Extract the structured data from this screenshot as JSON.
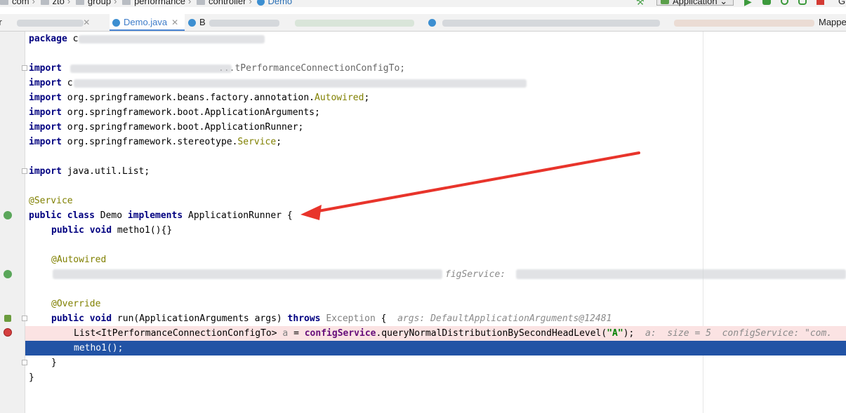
{
  "breadcrumb": {
    "items": [
      {
        "label": "com",
        "icon": "folder-icon"
      },
      {
        "label": "zto",
        "icon": "folder-icon"
      },
      {
        "label": "group",
        "icon": "folder-icon"
      },
      {
        "label": "performance",
        "icon": "folder-icon"
      },
      {
        "label": "controller",
        "icon": "folder-icon"
      },
      {
        "label": "Demo",
        "icon": "class-icon"
      }
    ]
  },
  "toolbar": {
    "run_config": "Application",
    "git_label": "G"
  },
  "tabs": [
    {
      "label": "rr",
      "active": false
    },
    {
      "label": "Demo.java",
      "active": true
    },
    {
      "label": "B",
      "active": false
    },
    {
      "label": "",
      "active": false
    },
    {
      "label": "Mappe",
      "active": false
    }
  ],
  "code": {
    "line1": {
      "kw": "package",
      "rest": " c"
    },
    "line3": {
      "kw": "import",
      "rest": " ",
      "tail": "...tPerformanceConnectionConfigTo;"
    },
    "line4": {
      "kw": "import",
      "rest": " c"
    },
    "line5": {
      "kw": "import",
      "rest": " org.springframework.beans.factory.annotation.",
      "ann": "Autowired",
      "end": ";"
    },
    "line6": {
      "kw": "import",
      "rest": " org.springframework.boot.ApplicationArguments;"
    },
    "line7": {
      "kw": "import",
      "rest": " org.springframework.boot.ApplicationRunner;"
    },
    "line8": {
      "kw": "import",
      "rest": " org.springframework.stereotype.",
      "ann": "Service",
      "end": ";"
    },
    "line10": {
      "kw": "import",
      "rest": " java.util.List;"
    },
    "line12": {
      "ann": "@Service"
    },
    "line13": {
      "kw1": "public class",
      "name": " Demo ",
      "kw2": "implements",
      "rest": " ApplicationRunner {"
    },
    "line14": {
      "kw": "public void",
      "rest": " metho1(){}"
    },
    "line16": {
      "ann": "@Autowired"
    },
    "line17": {
      "hint": "figService:"
    },
    "line19": {
      "ann": "@Override"
    },
    "line20": {
      "kw": "public void",
      "rest": " run(ApplicationArguments args) ",
      "kw2": "throws",
      "exc": " Exception",
      "brace": " {",
      "hint": "  args: DefaultApplicationArguments@12481"
    },
    "line21": {
      "pre": "List<ItPerformanceConnectionConfigTo> ",
      "var": "a",
      "eq": " = ",
      "field": "configService",
      "call": ".queryNormalDistributionBySecondHeadLevel(",
      "str": "\"A\"",
      "end": ");",
      "hint": "  a:  size = 5  configService: \"com."
    },
    "line22": {
      "text": "metho1();"
    },
    "line23": {
      "text": "}"
    },
    "line24": {
      "text": "}"
    }
  },
  "colors": {
    "keyword": "#000080",
    "annotation": "#808000",
    "string": "#008000",
    "field": "#660e7a",
    "execution_line": "#2253a5",
    "breakpoint_line": "#fbe3e3",
    "arrow": "#e8342b"
  }
}
